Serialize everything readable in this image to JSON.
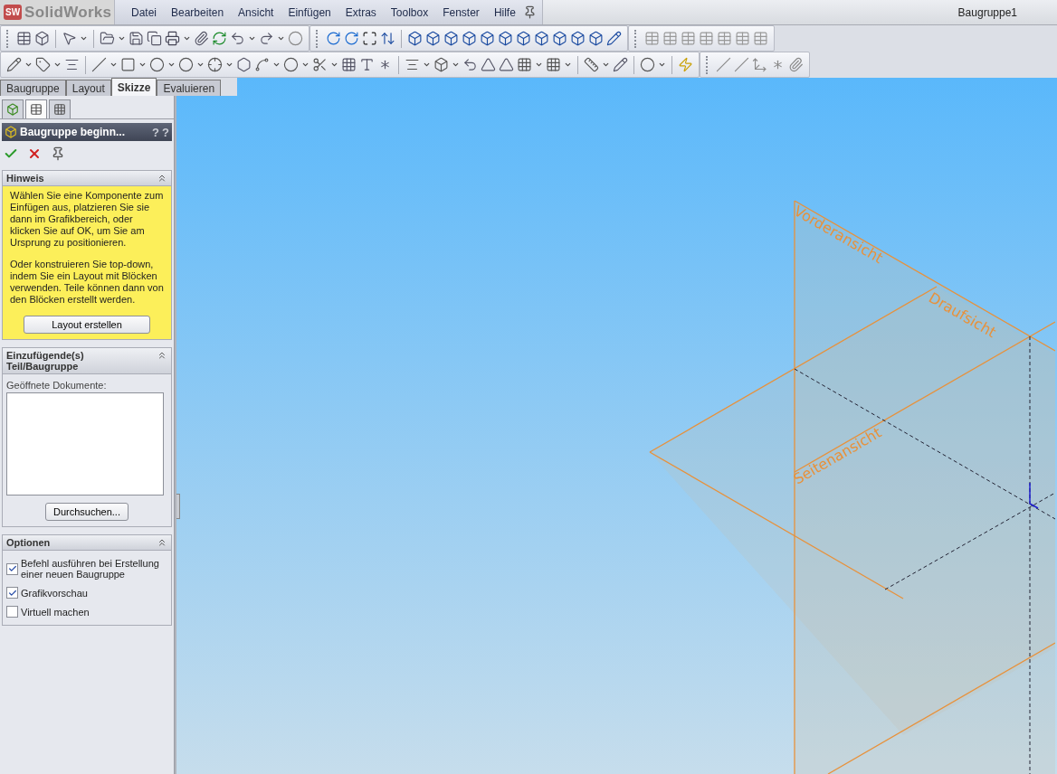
{
  "logo": {
    "badge": "SW",
    "text": "SolidWorks"
  },
  "menu": [
    "Datei",
    "Bearbeiten",
    "Ansicht",
    "Einfügen",
    "Extras",
    "Toolbox",
    "Fenster",
    "Hilfe"
  ],
  "window": {
    "title": "Baugruppe1"
  },
  "tabs": [
    {
      "label": "Baugruppe",
      "selected": false
    },
    {
      "label": "Layout",
      "selected": false
    },
    {
      "label": "Skizze",
      "selected": true
    },
    {
      "label": "Evaluieren",
      "selected": false
    }
  ],
  "property_manager": {
    "panel_tabs": [
      {
        "selected": false
      },
      {
        "selected": true
      },
      {
        "selected": false
      }
    ],
    "title": "Baugruppe beginn...",
    "help_buttons": [
      "?",
      "?"
    ],
    "hint": {
      "title": "Hinweis",
      "paragraphs": [
        "Wählen Sie eine Komponente zum Einfügen aus, platzieren Sie sie dann im Grafikbereich, oder klicken Sie auf OK, um Sie am Ursprung zu positionieren.",
        "Oder konstruieren Sie top-down, indem Sie ein Layout mit Blöcken verwenden. Teile können dann von den Blöcken erstellt werden."
      ],
      "button": "Layout erstellen"
    },
    "insert": {
      "title": "Einzufügende(s) Teil/Baugruppe",
      "list_label": "Geöffnete Dokumente:",
      "button": "Durchsuchen..."
    },
    "options": {
      "title": "Optionen",
      "items": [
        {
          "label": "Befehl ausführen bei Erstellung einer neuen Baugruppe",
          "checked": true
        },
        {
          "label": "Grafikvorschau",
          "checked": true
        },
        {
          "label": "Virtuell machen",
          "checked": false
        }
      ]
    }
  },
  "viewport": {
    "planes": [
      "Vorderansicht",
      "Draufsicht",
      "Seitenansicht"
    ]
  }
}
